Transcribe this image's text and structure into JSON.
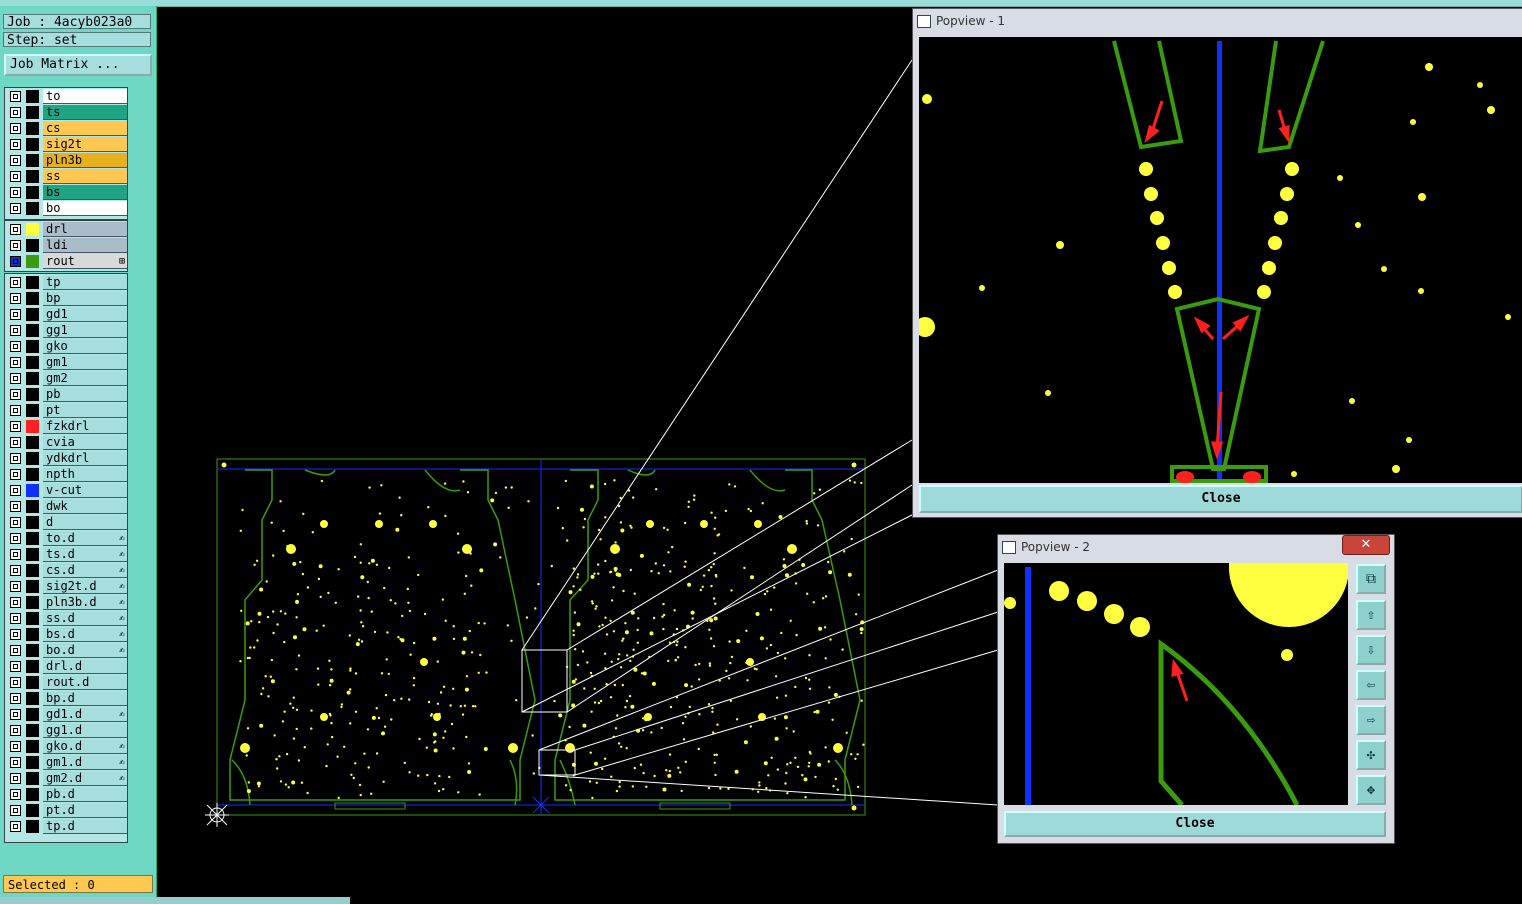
{
  "job_label": "Job : 4acyb023a0",
  "step_label": "Step: set",
  "job_matrix_button": "Job Matrix ...",
  "layers_group1": [
    {
      "name": "to",
      "color": "#ffffff"
    },
    {
      "name": "ts",
      "color": "#1fa584"
    },
    {
      "name": "cs",
      "color": "#ffc850"
    },
    {
      "name": "sig2t",
      "color": "#ffc850"
    },
    {
      "name": "pln3b",
      "color": "#e6b01e"
    },
    {
      "name": "ss",
      "color": "#ffc850"
    },
    {
      "name": "bs",
      "color": "#1fa584"
    },
    {
      "name": "bo",
      "color": "#ffffff"
    }
  ],
  "layers_group2": [
    {
      "name": "drl",
      "color": "#a9bcc8",
      "swatch": "#ffff40"
    },
    {
      "name": "ldi",
      "color": "#a9bcc8",
      "swatch": ""
    },
    {
      "name": "rout",
      "color": "#d9d9d9",
      "swatch": "#3a9a10"
    }
  ],
  "layers_group3": [
    {
      "name": "tp"
    },
    {
      "name": "bp"
    },
    {
      "name": "gd1"
    },
    {
      "name": "gg1"
    },
    {
      "name": "gko"
    },
    {
      "name": "gm1"
    },
    {
      "name": "gm2"
    },
    {
      "name": "pb"
    },
    {
      "name": "pt"
    },
    {
      "name": "fzkdrl",
      "swatch": "#ff2020"
    },
    {
      "name": "cvia"
    },
    {
      "name": "ydkdrl"
    },
    {
      "name": "npth"
    },
    {
      "name": "v-cut",
      "swatch": "#1030ff"
    },
    {
      "name": "dwk"
    },
    {
      "name": "d"
    },
    {
      "name": "to.d",
      "mark": true
    },
    {
      "name": "ts.d",
      "mark": true
    },
    {
      "name": "cs.d",
      "mark": true
    },
    {
      "name": "sig2t.d",
      "mark": true
    },
    {
      "name": "pln3b.d",
      "mark": true
    },
    {
      "name": "ss.d",
      "mark": true
    },
    {
      "name": "bs.d",
      "mark": true
    },
    {
      "name": "bo.d",
      "mark": true
    },
    {
      "name": "drl.d"
    },
    {
      "name": "rout.d"
    },
    {
      "name": "bp.d"
    },
    {
      "name": "gd1.d",
      "mark": true
    },
    {
      "name": "gg1.d"
    },
    {
      "name": "gko.d",
      "mark": true
    },
    {
      "name": "gm1.d",
      "mark": true
    },
    {
      "name": "gm2.d",
      "mark": true
    },
    {
      "name": "pb.d"
    },
    {
      "name": "pt.d"
    },
    {
      "name": "tp.d"
    }
  ],
  "selected_label": "Selected : 0",
  "popview1": {
    "title": "Popview - 1",
    "close_label": "Close"
  },
  "popview2": {
    "title": "Popview - 2",
    "close_label": "Close",
    "close_x": "✕"
  },
  "toolbar_icons": [
    "zoom-fit-icon",
    "pan-up-icon",
    "pan-down-icon",
    "pan-left-icon",
    "pan-right-icon",
    "zoom-out-icon",
    "zoom-in-icon"
  ],
  "colors": {
    "panel": "#6fd8c4",
    "board_outline": "#3a9a10",
    "vcut": "#1030ff",
    "pad": "#ffff40",
    "arrow": "#ff2020"
  }
}
